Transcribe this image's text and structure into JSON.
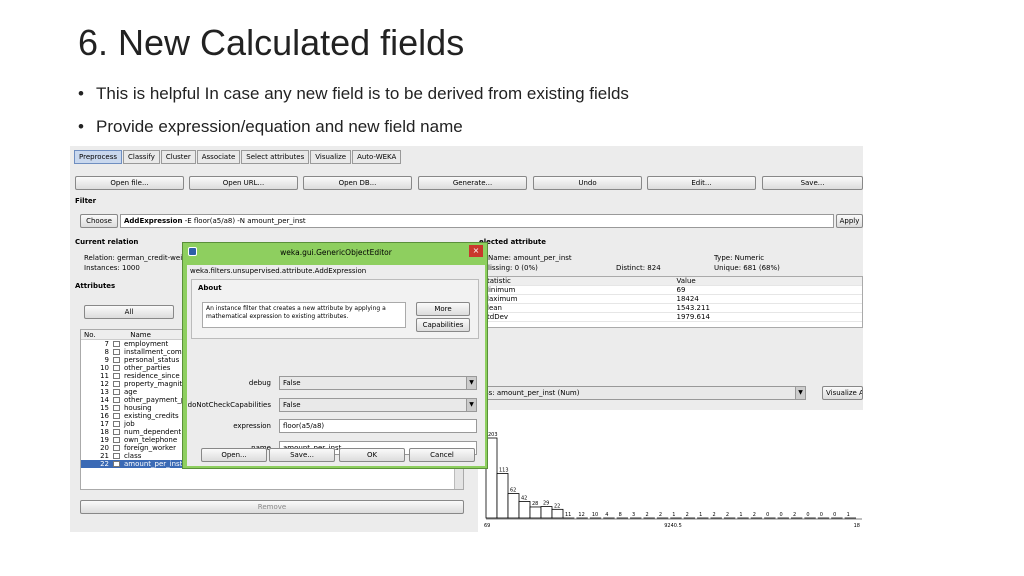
{
  "slide": {
    "title": "6. New Calculated fields",
    "bullets": [
      "This is helpful In case any new field is to be derived from existing fields",
      "Provide expression/equation and new field name"
    ]
  },
  "tabs": [
    "Preprocess",
    "Classify",
    "Cluster",
    "Associate",
    "Select attributes",
    "Visualize",
    "Auto-WEKA"
  ],
  "toolbar": [
    "Open file...",
    "Open URL...",
    "Open DB...",
    "Generate...",
    "Undo",
    "Edit...",
    "Save..."
  ],
  "filter": {
    "label": "Filter",
    "choose": "Choose",
    "name": "AddExpression",
    "args": "-E floor(a5/a8) -N amount_per_inst",
    "apply": "Apply"
  },
  "relation": {
    "label": "Current relation",
    "relation": "Relation: german_credit-wei",
    "instances": "Instances: 1000"
  },
  "attributes": {
    "label": "Attributes",
    "all": "All",
    "header_no": "No.",
    "header_name": "Name",
    "rows": [
      {
        "no": "7",
        "name": "employment"
      },
      {
        "no": "8",
        "name": "installment_comi"
      },
      {
        "no": "9",
        "name": "personal_status"
      },
      {
        "no": "10",
        "name": "other_parties"
      },
      {
        "no": "11",
        "name": "residence_since"
      },
      {
        "no": "12",
        "name": "property_magnitu"
      },
      {
        "no": "13",
        "name": "age"
      },
      {
        "no": "14",
        "name": "other_payment_p"
      },
      {
        "no": "15",
        "name": "housing"
      },
      {
        "no": "16",
        "name": "existing_credits"
      },
      {
        "no": "17",
        "name": "job"
      },
      {
        "no": "18",
        "name": "num_dependent"
      },
      {
        "no": "19",
        "name": "own_telephone"
      },
      {
        "no": "20",
        "name": "foreign_worker"
      },
      {
        "no": "21",
        "name": "class"
      },
      {
        "no": "22",
        "name": "amount_per_inst"
      }
    ],
    "remove": "Remove"
  },
  "selected": {
    "label": "elected attribute",
    "name": "Name: amount_per_inst",
    "missing": "lissing: 0 (0%)",
    "distinct": "Distinct: 824",
    "type": "Type: Numeric",
    "unique": "Unique: 681 (68%)",
    "stat_header": "tatistic",
    "value_header": "Value",
    "stats": [
      {
        "name": "linimum",
        "value": "69"
      },
      {
        "name": "laximum",
        "value": "18424"
      },
      {
        "name": "lean",
        "value": "1543.211"
      },
      {
        "name": "tdDev",
        "value": "1979.614"
      }
    ]
  },
  "class_select": "ss: amount_per_inst (Num)",
  "visualize_all": "Visualize A",
  "histogram": {
    "bars": [
      {
        "label": "203",
        "value": 203
      },
      {
        "label": "113",
        "value": 113
      },
      {
        "label": "62",
        "value": 62
      },
      {
        "label": "42",
        "value": 42
      },
      {
        "label": "28",
        "value": 28
      },
      {
        "label": "29",
        "value": 29
      },
      {
        "label": "22",
        "value": 22
      }
    ],
    "tail_labels": [
      "11",
      "12",
      "10",
      "4",
      "8",
      "3",
      "2",
      "2",
      "1",
      "2",
      "1",
      "2",
      "2",
      "1",
      "2",
      "0",
      "0",
      "2",
      "0",
      "0",
      "0",
      "1"
    ],
    "axis": [
      "69",
      "9240.5",
      "18"
    ]
  },
  "dialog": {
    "title": "weka.gui.GenericObjectEditor",
    "close": "×",
    "classname": "weka.filters.unsupervised.attribute.AddExpression",
    "about_label": "About",
    "about_text": "An instance filter that creates a new attribute by applying a mathematical expression to existing attributes.",
    "more": "More",
    "capabilities": "Capabilities",
    "debug_label": "debug",
    "debug_value": "False",
    "dncc_label": "doNotCheckCapabilities",
    "dncc_value": "False",
    "expression_label": "expression",
    "expression_value": "floor(a5/a8)",
    "name_label": "name",
    "name_value": "amount_per_inst",
    "open": "Open...",
    "save": "Save...",
    "ok": "OK",
    "cancel": "Cancel"
  }
}
